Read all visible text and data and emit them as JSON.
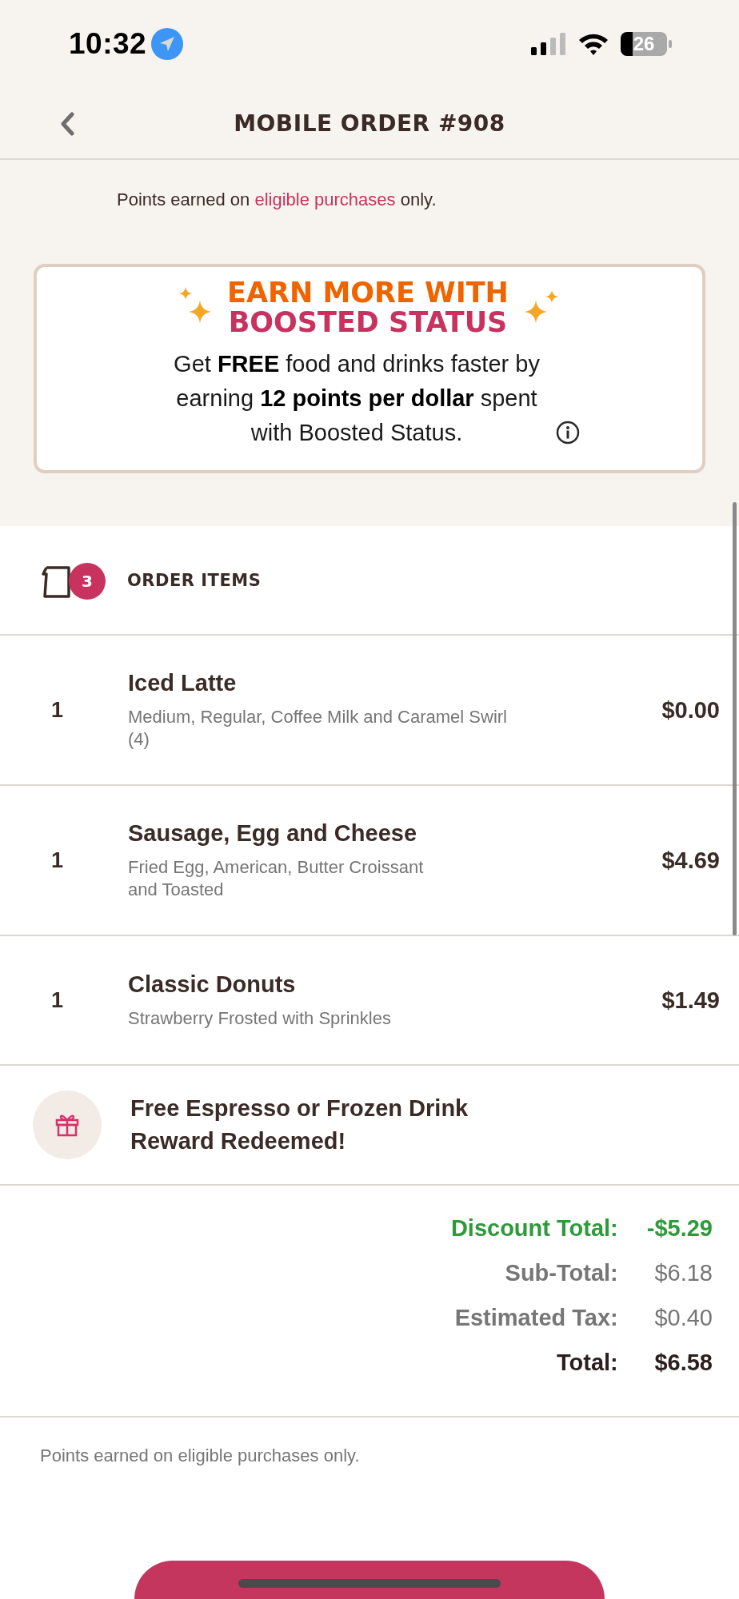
{
  "status_bar": {
    "time": "10:32",
    "battery": "26"
  },
  "header": {
    "title": "MOBILE ORDER #908"
  },
  "points_note": {
    "prefix": "Points earned on ",
    "link": "eligible purchases",
    "suffix": " only."
  },
  "promo": {
    "title_line_1": "EARN MORE WITH",
    "title_line_2": "BOOSTED STATUS",
    "body": "Get **FREE** food and drinks faster by earning **12 points per dollar** spent with Boosted Status."
  },
  "order_items": {
    "title": "ORDER ITEMS",
    "count": "3",
    "items": [
      {
        "quantity": "1",
        "name": "Iced Latte",
        "detail_lines": [
          "Medium, Regular, Coffee Milk and Caramel Swirl",
          "(4)"
        ],
        "price": "$0.00"
      },
      {
        "quantity": "1",
        "name": "Sausage, Egg and Cheese",
        "detail_lines": [
          "Fried Egg, American, Butter Croissant",
          "and Toasted"
        ],
        "price": "$4.69"
      },
      {
        "quantity": "1",
        "name": "Classic Donuts",
        "detail_lines": [
          "Strawberry Frosted with Sprinkles"
        ],
        "price": "$1.49"
      }
    ]
  },
  "reward": {
    "text": "Free Espresso or Frozen Drink Reward Redeemed!"
  },
  "totals": [
    {
      "kind": "discount",
      "label": "Discount Total:",
      "value": "-$5.29"
    },
    {
      "kind": "muted",
      "label": "Sub-Total:",
      "value": "$6.18"
    },
    {
      "kind": "muted",
      "label": "Estimated Tax:",
      "value": "$0.40"
    },
    {
      "kind": "total",
      "label": "Total:",
      "value": "$6.58"
    }
  ],
  "footer_note": "Points earned on eligible purchases only."
}
